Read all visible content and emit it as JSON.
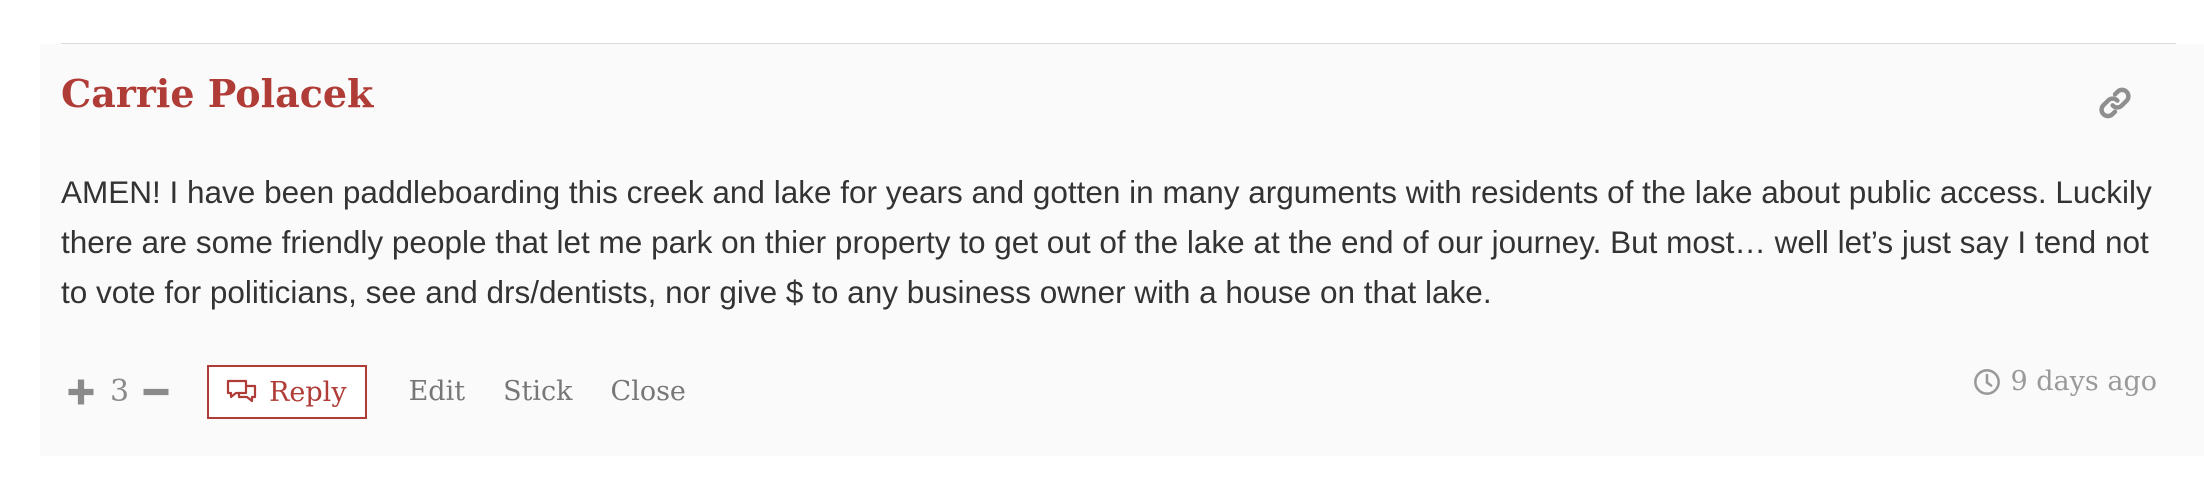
{
  "comment": {
    "author": "Carrie Polacek",
    "text": "AMEN! I have been paddleboarding this creek and lake for years and gotten in many arguments with residents of the lake about public access. Luckily there are some friendly people that let me park on thier property to get out of the lake at the end of our journey. But most… well let’s just say I tend not to vote for politicians, see and drs/dentists, nor give $ to any business owner with a house on that lake.",
    "score": "3",
    "timestamp": "9 days ago"
  },
  "actions": {
    "reply_label": "Reply",
    "edit_label": "Edit",
    "stick_label": "Stick",
    "close_label": "Close"
  },
  "icons": {
    "permalink": "link-icon",
    "upvote": "plus-icon",
    "downvote": "minus-icon",
    "reply": "speech-bubbles-icon",
    "time": "clock-icon"
  },
  "colors": {
    "accent": "#b03c37",
    "text": "#333333",
    "muted": "#8a8a8a",
    "background": "#fbfafa"
  }
}
